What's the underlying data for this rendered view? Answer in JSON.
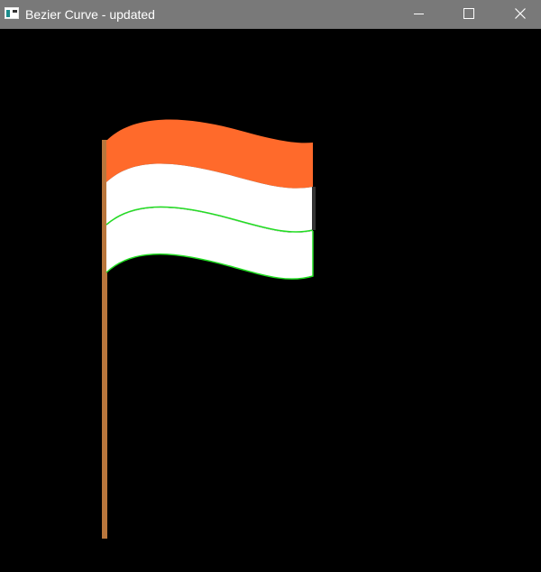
{
  "window": {
    "title": "Bezier Curve - updated"
  },
  "icons": {
    "app": "app-window-icon",
    "minimize": "minimize-icon",
    "maximize": "maximize-icon",
    "close": "close-icon"
  },
  "colors": {
    "titlebar": "#797979",
    "background": "#000000",
    "pole": "#b9763c",
    "saffron": "#ff6a2b",
    "white": "#ffffff",
    "green_outline": "#22dd22"
  }
}
